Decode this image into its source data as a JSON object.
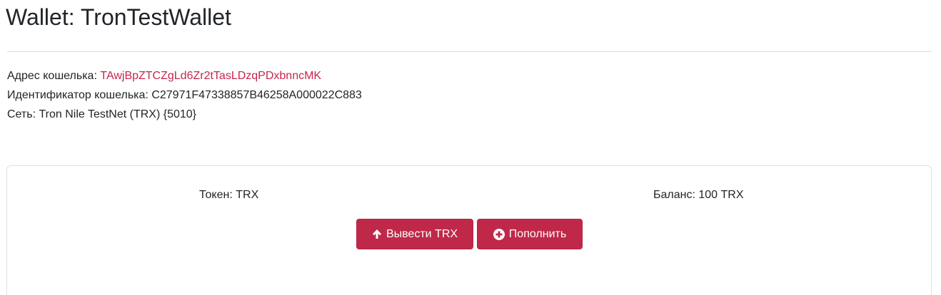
{
  "header": {
    "title": "Wallet: TronTestWallet"
  },
  "wallet_info": {
    "address_label": "Адрес кошелька:",
    "address_value": "TAwjBpZTCZgLd6Zr2tTasLDzqPDxbnncMK",
    "id_label": "Идентификатор кошелька:",
    "id_value": "C27971F47338857B46258A000022C883",
    "network_label": "Сеть:",
    "network_value": "Tron Nile TestNet (TRX) {5010}"
  },
  "token_card": {
    "token_label": "Токен:",
    "token_value": "TRX",
    "balance_label": "Баланс:",
    "balance_value": "100 TRX",
    "withdraw_button": "Вывести TRX",
    "topup_button": "Пополнить"
  },
  "colors": {
    "accent": "#c0284a",
    "address_link": "#c7254e"
  },
  "icons": {
    "withdraw": "arrow-up-icon",
    "topup": "plus-circle-icon"
  }
}
